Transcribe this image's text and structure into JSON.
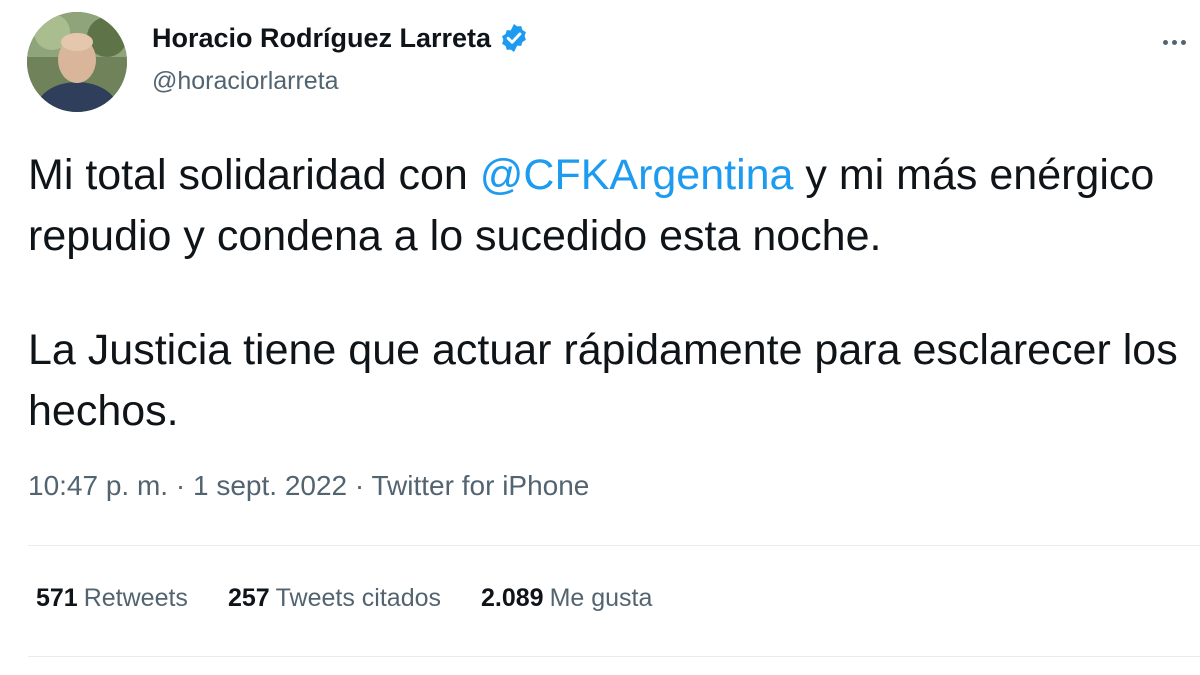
{
  "author": {
    "display_name": "Horacio Rodríguez Larreta",
    "handle": "@horaciorlarreta",
    "avatar_icon": "profile-photo",
    "verified_icon": "verified-badge-icon"
  },
  "menu": {
    "icon": "more-options-icon"
  },
  "tweet": {
    "line1_before": "Mi total solidaridad con ",
    "mention": "@CFKArgentina",
    "line1_after": " y mi más enérgico repudio y condena a lo sucedido esta noche.",
    "paragraph2": "La Justicia tiene que actuar rápidamente para esclarecer los hechos."
  },
  "meta": {
    "time": "10:47 p. m.",
    "sep1": " · ",
    "date": "1 sept. 2022",
    "sep2": " · ",
    "source": "Twitter for iPhone"
  },
  "stats": [
    {
      "count": "571",
      "label": "Retweets"
    },
    {
      "count": "257",
      "label": "Tweets citados"
    },
    {
      "count": "2.089",
      "label": "Me gusta"
    }
  ],
  "colors": {
    "accent": "#1d9bf0",
    "text": "#0f1419",
    "secondary": "#536471",
    "divider": "#e6ecf0"
  }
}
